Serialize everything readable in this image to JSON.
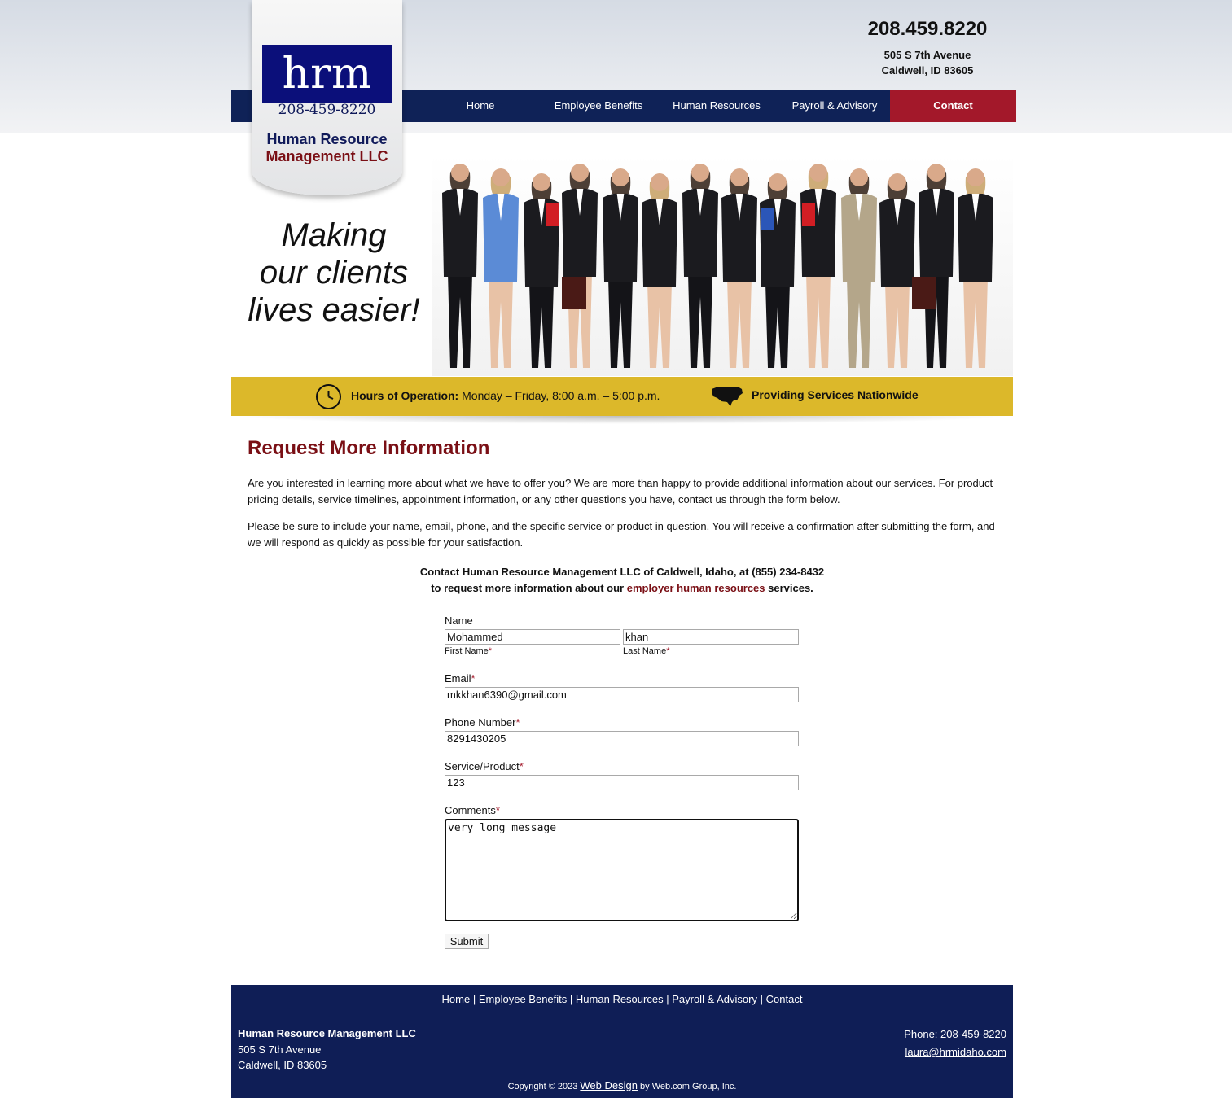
{
  "header": {
    "phone": "208.459.8220",
    "address_line1": "505 S 7th Avenue",
    "address_line2": "Caldwell, ID 83605"
  },
  "logo": {
    "mark": "hrm",
    "phone": "208-459-8220",
    "name_line1": "Human Resource",
    "name_line2": "Management LLC"
  },
  "nav": {
    "items": [
      "Home",
      "Employee Benefits",
      "Human Resources",
      "Payroll & Advisory",
      "Contact"
    ]
  },
  "banner": {
    "tagline_1": "Making",
    "tagline_2": "our clients",
    "tagline_3": "lives easier!",
    "hours_label": "Hours of Operation:",
    "hours_value": "Monday – Friday, 8:00 a.m. – 5:00 p.m.",
    "nationwide": "Providing Services Nationwide"
  },
  "content": {
    "title": "Request More Information",
    "para1": "Are you interested in learning more about what we have to offer you? We are more than happy to provide additional information about our services. For product pricing details, service timelines, appointment information, or any other questions you have, contact us through the form below.",
    "para2": "Please be sure to include your name, email, phone, and the specific service or product in question. You will receive a confirmation after submitting the form, and we will respond as quickly as possible for your satisfaction.",
    "callout_line1": "Contact Human Resource Management LLC of Caldwell, Idaho, at (855) 234-8432",
    "callout_line2_pre": "to request more information about our ",
    "callout_link": "employer human resources",
    "callout_line2_post": " services."
  },
  "form": {
    "name_label": "Name",
    "first_name_label": "First Name",
    "last_name_label": "Last Name",
    "first_name_value": "Mohammed",
    "last_name_value": "khan",
    "email_label": "Email",
    "email_value": "mkkhan6390@gmail.com",
    "phone_label": "Phone Number",
    "phone_value": "8291430205",
    "service_label": "Service/Product",
    "service_value": "123",
    "comments_label": "Comments",
    "comments_value": "very long message",
    "required_mark": "*",
    "submit_label": "Submit"
  },
  "footer": {
    "links": [
      "Home",
      "Employee Benefits",
      "Human Resources",
      "Payroll & Advisory",
      "Contact"
    ],
    "separator": "|",
    "company": "Human Resource Management LLC",
    "address_line1": "505 S 7th Avenue",
    "address_line2": "Caldwell, ID 83605",
    "phone": "Phone: 208-459-8220",
    "email": "laura@hrmidaho.com",
    "copyright_pre": "Copyright © 2023 ",
    "copyright_link": "Web Design",
    "copyright_post": " by Web.com Group, Inc."
  },
  "colors": {
    "navy": "#0f2257",
    "maroon": "#7a0f15",
    "contact_red": "#a3182a",
    "gold": "#dcb82a"
  }
}
